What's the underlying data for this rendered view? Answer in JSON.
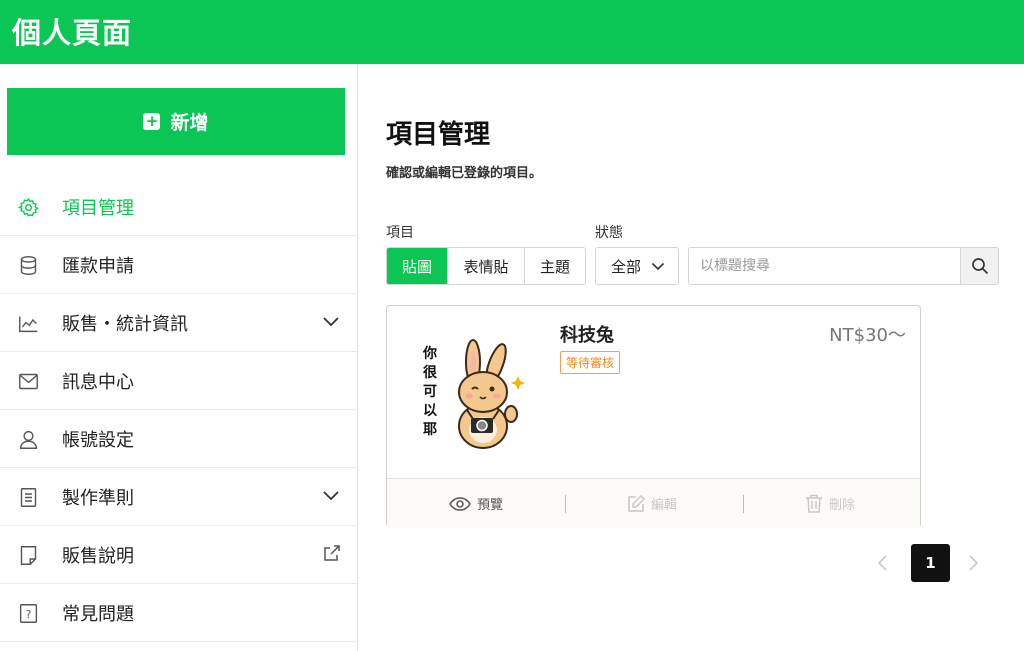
{
  "header": {
    "title": "個人頁面"
  },
  "sidebar": {
    "add_label": "新增",
    "items": [
      {
        "label": "項目管理",
        "icon": "gear-icon",
        "active": true
      },
      {
        "label": "匯款申請",
        "icon": "database-icon"
      },
      {
        "label": "販售・統計資訊",
        "icon": "chart-icon",
        "expandable": true
      },
      {
        "label": "訊息中心",
        "icon": "mail-icon"
      },
      {
        "label": "帳號設定",
        "icon": "user-icon"
      },
      {
        "label": "製作準則",
        "icon": "document-icon",
        "expandable": true
      },
      {
        "label": "販售說明",
        "icon": "note-icon",
        "external": true
      },
      {
        "label": "常見問題",
        "icon": "question-icon"
      }
    ]
  },
  "main": {
    "title": "項目管理",
    "description": "確認或編輯已登錄的項目。",
    "filter": {
      "item_label": "項目",
      "types": [
        "貼圖",
        "表情貼",
        "主題"
      ],
      "selected_type": "貼圖",
      "status_label": "狀態",
      "status_value": "全部",
      "search_placeholder": "以標題搜尋"
    },
    "card": {
      "title": "科技兔",
      "status_badge": "等待審核",
      "price": "NT$30～",
      "sticker_text": "你很可以耶",
      "view_label": "預覽",
      "edit_label": "編輯",
      "delete_label": "刪除"
    },
    "pagination": {
      "current_page": "1"
    }
  },
  "colors": {
    "brand_green": "#0bc654",
    "badge_orange": "#f08a1c"
  }
}
